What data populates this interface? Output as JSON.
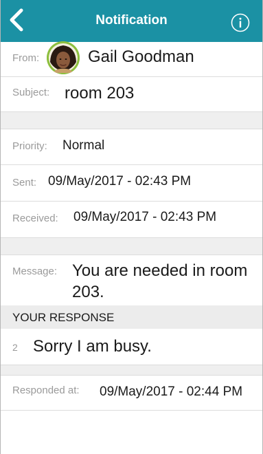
{
  "header": {
    "title": "Notification",
    "back_icon": "chevron-left-icon",
    "info_icon": "info-circle-icon",
    "bar_color": "#1b91a4"
  },
  "from": {
    "label": "From:",
    "name": "Gail Goodman",
    "avatar_ring_color": "#8dbf3e"
  },
  "subject": {
    "label": "Subject:",
    "value": "room 203"
  },
  "priority": {
    "label": "Priority:",
    "value": "Normal"
  },
  "sent": {
    "label": "Sent:",
    "value": "09/May/2017 - 02:43 PM"
  },
  "received": {
    "label": "Received:",
    "value": "09/May/2017 - 02:43 PM"
  },
  "message": {
    "label": "Message:",
    "line1": "You are needed in room",
    "line2": "203."
  },
  "response_section": {
    "header": "YOUR RESPONSE",
    "index": "2",
    "text": "Sorry I am busy."
  },
  "responded": {
    "label": "Responded at:",
    "value": "09/May/2017 - 02:44 PM"
  }
}
